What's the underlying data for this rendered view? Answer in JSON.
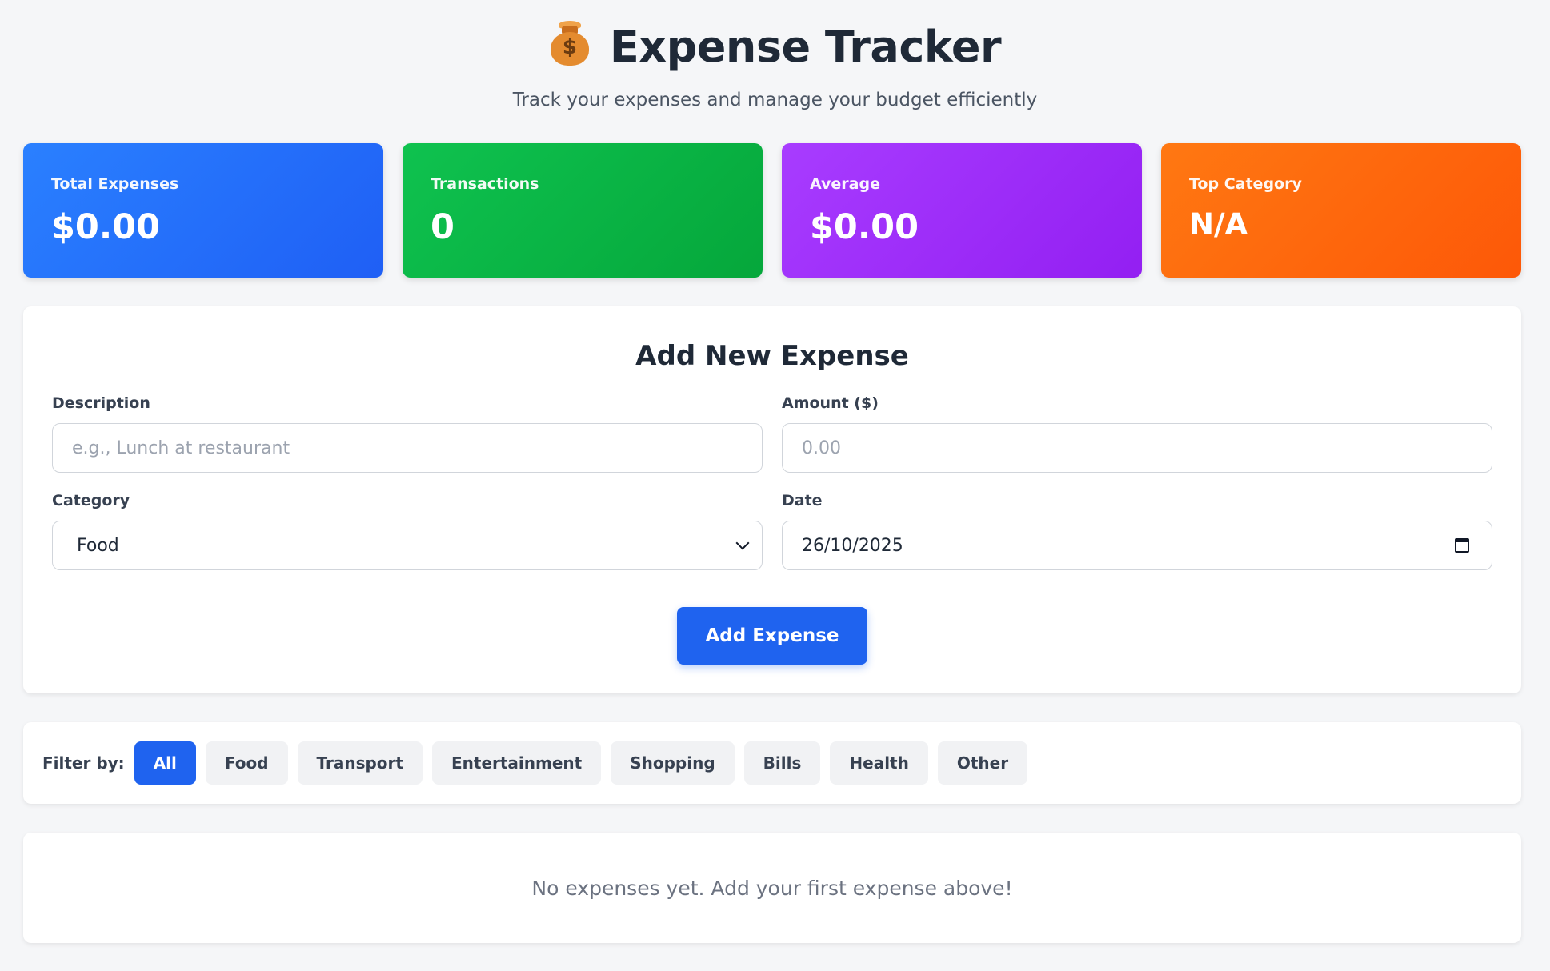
{
  "header": {
    "icon": "money-bag-icon",
    "title": "Expense Tracker",
    "subtitle": "Track your expenses and manage your budget efficiently"
  },
  "stats": [
    {
      "label": "Total Expenses",
      "value": "$0.00",
      "color": "#2563eb"
    },
    {
      "label": "Transactions",
      "value": "0",
      "color": "#0db14a"
    },
    {
      "label": "Average",
      "value": "$0.00",
      "color": "#9d2ff7"
    },
    {
      "label": "Top Category",
      "value": "N/A",
      "color": "#fb6510"
    }
  ],
  "form": {
    "title": "Add New Expense",
    "description": {
      "label": "Description",
      "placeholder": "e.g., Lunch at restaurant",
      "value": ""
    },
    "amount": {
      "label": "Amount ($)",
      "placeholder": "0.00",
      "value": ""
    },
    "category": {
      "label": "Category",
      "value": "Food"
    },
    "date": {
      "label": "Date",
      "value": "26/10/2025"
    },
    "submit_label": "Add Expense"
  },
  "filter": {
    "label": "Filter by:",
    "active": "All",
    "options": [
      "All",
      "Food",
      "Transport",
      "Entertainment",
      "Shopping",
      "Bills",
      "Health",
      "Other"
    ]
  },
  "list": {
    "empty_message": "No expenses yet. Add your first expense above!"
  },
  "colors": {
    "accent": "#1f63ef",
    "page_background": "#f5f6f8"
  }
}
